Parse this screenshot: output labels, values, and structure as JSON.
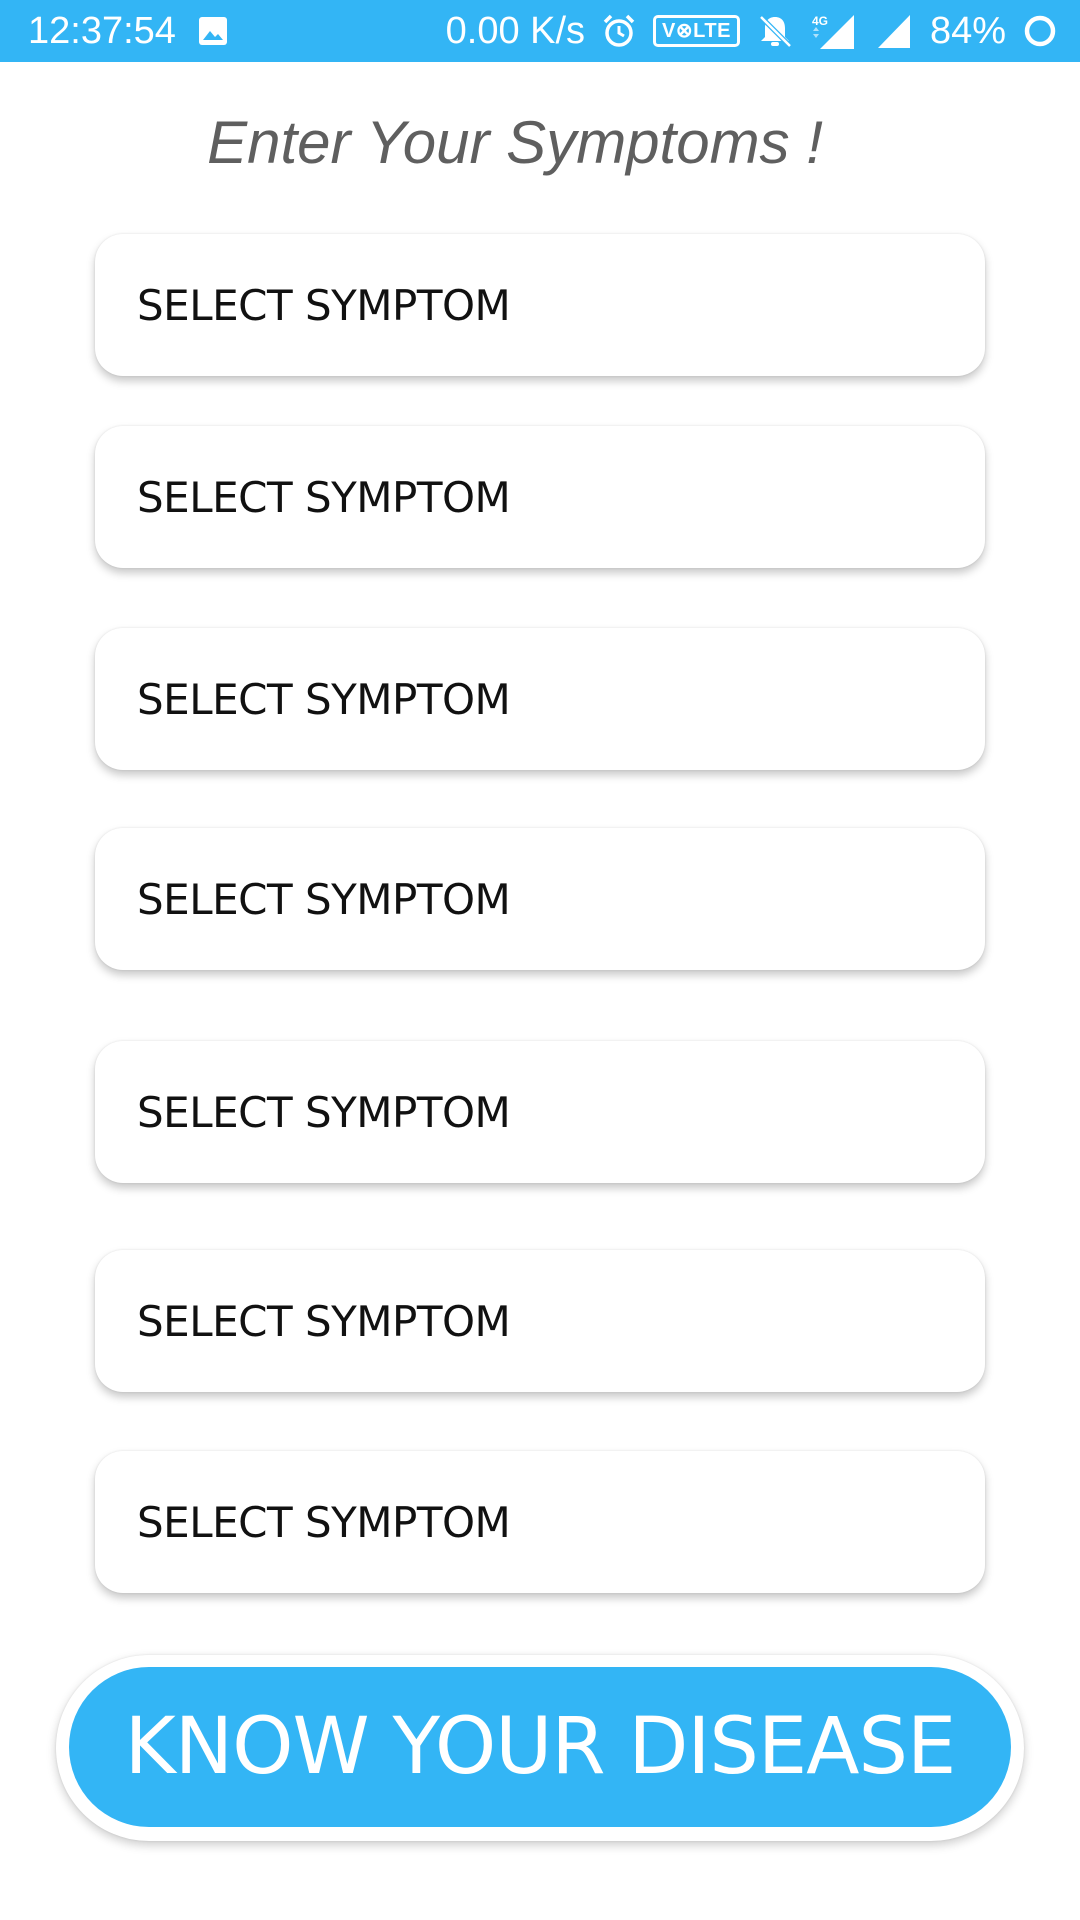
{
  "status_bar": {
    "time": "12:37:54",
    "network_speed": "0.00 K/s",
    "volte": "V⊗LTE",
    "network_type": "4G",
    "battery": "84%",
    "icons": [
      "image-icon",
      "alarm-icon",
      "volte-icon",
      "bell-off-icon",
      "signal-4g-icon",
      "signal-icon",
      "battery-ring-icon"
    ]
  },
  "page": {
    "title": "Enter Your Symptoms !"
  },
  "symptoms": [
    {
      "label": "SELECT SYMPTOM"
    },
    {
      "label": "SELECT SYMPTOM"
    },
    {
      "label": "SELECT SYMPTOM"
    },
    {
      "label": "SELECT SYMPTOM"
    },
    {
      "label": "SELECT SYMPTOM"
    },
    {
      "label": "SELECT SYMPTOM"
    },
    {
      "label": "SELECT SYMPTOM"
    }
  ],
  "predict_button": {
    "label": "KNOW YOUR DISEASE"
  },
  "colors": {
    "accent": "#33b5f5",
    "title_text": "#5f5f5f",
    "card_text": "#111111",
    "background": "#ffffff"
  }
}
